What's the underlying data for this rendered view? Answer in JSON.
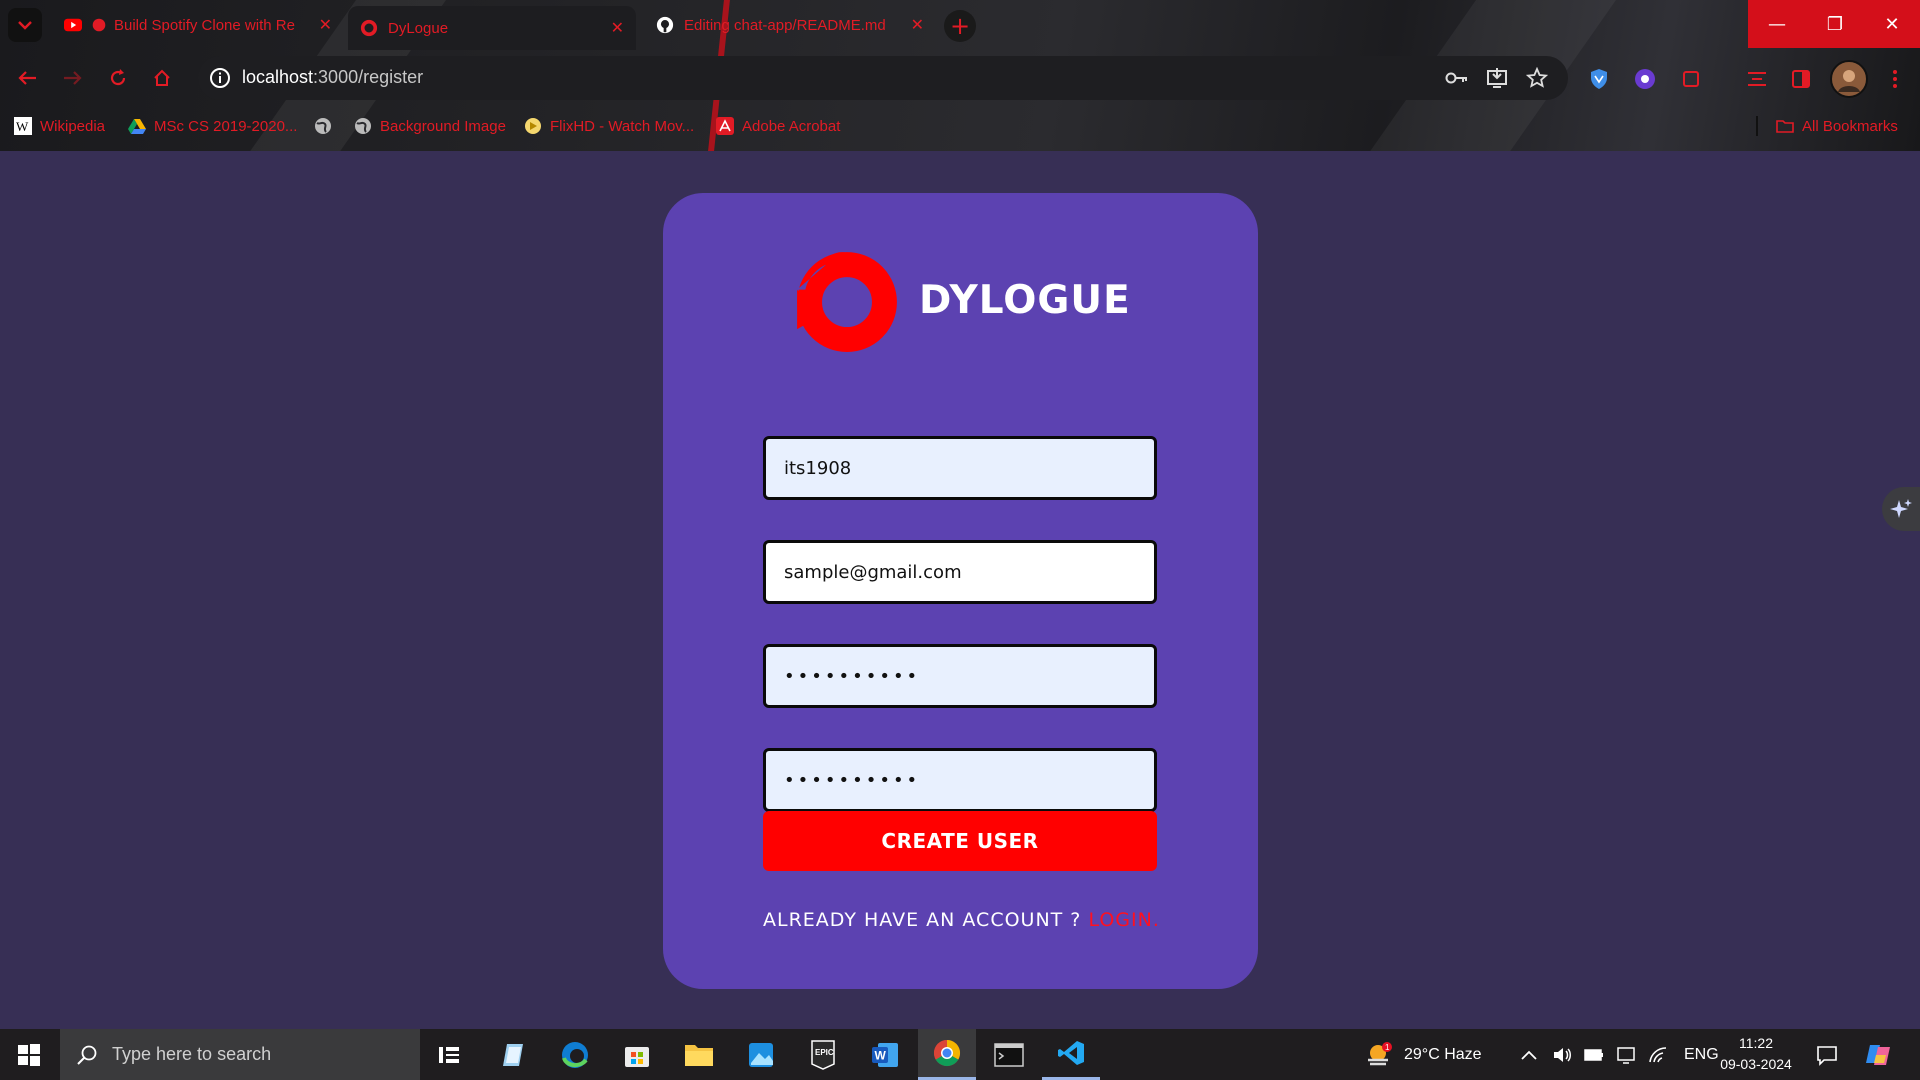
{
  "browser": {
    "tabs": [
      {
        "title": "Build Spotify Clone with Re",
        "favicon": "youtube-icon"
      },
      {
        "title": "DyLogue",
        "favicon": "dylogue-icon"
      },
      {
        "title": "Editing chat-app/README.md",
        "favicon": "github-icon"
      }
    ],
    "url_host": "localhost",
    "url_path": ":3000/register",
    "bookmarks": [
      {
        "label": "Wikipedia",
        "icon": "wikipedia-icon"
      },
      {
        "label": "MSc CS 2019-2020...",
        "icon": "google-drive-icon"
      },
      {
        "label": "",
        "icon": "globe-icon"
      },
      {
        "label": "Background Image",
        "icon": "globe-icon"
      },
      {
        "label": "FlixHD - Watch Mov...",
        "icon": "flixhd-icon"
      },
      {
        "label": "Adobe Acrobat",
        "icon": "acrobat-icon"
      }
    ],
    "all_bookmarks": "All Bookmarks",
    "accent": "#e21b25"
  },
  "register": {
    "brand": "DYLOGUE",
    "username": "its1908",
    "email": "sample@gmail.com",
    "password_mask": "••••••••••",
    "confirm_mask": "••••••••••",
    "create_button": "CREATE USER",
    "already_text": "ALREADY HAVE AN ACCOUNT ? ",
    "login_link": "LOGIN.",
    "card_color": "#5c42b1",
    "button_color": "#ff0000"
  },
  "taskbar": {
    "search_placeholder": "Type here to search",
    "weather": "29°C  Haze",
    "language": "ENG",
    "time": "11:22",
    "date": "09-03-2024"
  }
}
